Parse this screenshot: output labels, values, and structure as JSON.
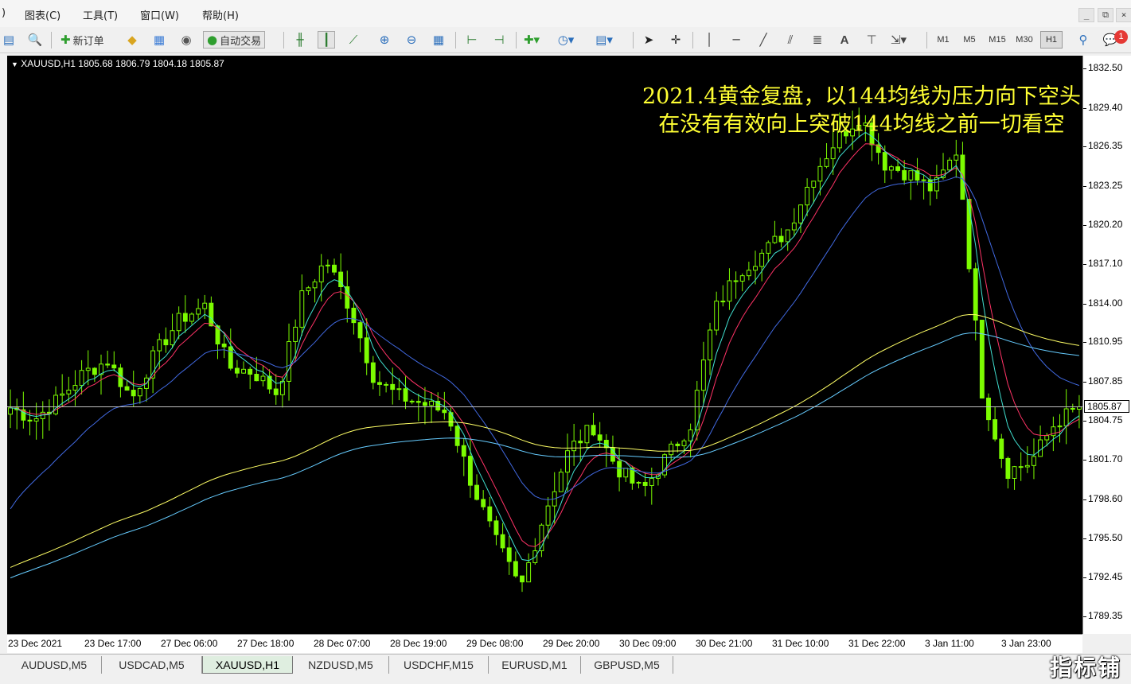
{
  "menu": {
    "items": [
      "图表(C)",
      "工具(T)",
      "窗口(W)",
      "帮助(H)"
    ],
    "first_fragment": ")"
  },
  "window_controls": {
    "minimize": "_",
    "restore": "⧉",
    "close": "×"
  },
  "toolbar": {
    "new_order_label": "新订单",
    "auto_trade_label": "自动交易",
    "timeframes": [
      "M1",
      "M5",
      "M15",
      "M30",
      "H1"
    ],
    "active_timeframe": "H1",
    "notification_count": "1",
    "icons": [
      "new-chart-icon",
      "profiles-icon",
      "new-order-icon",
      "metaeditor-icon",
      "market-watch-icon",
      "signals-icon",
      "auto-trading-icon",
      "bar-chart-icon",
      "candlestick-icon",
      "line-chart-icon",
      "zoom-in-icon",
      "zoom-out-icon",
      "tile-windows-icon",
      "autoscroll-icon",
      "chart-shift-icon",
      "indicators-icon",
      "periods-icon",
      "templates-icon",
      "cursor-icon",
      "crosshair-icon",
      "vertical-line-icon",
      "horizontal-line-icon",
      "trendline-icon",
      "equidistant-channel-icon",
      "fibonacci-icon",
      "text-icon",
      "text-label-icon",
      "arrows-icon",
      "search-icon",
      "chat-icon"
    ]
  },
  "chart": {
    "symbol_info": "XAUUSD,H1  1805.68 1806.79 1804.18 1805.87",
    "annotation_line1": "2021.4黄金复盘，以144均线为压力向下空头",
    "annotation_line2": "在没有有效向上突破144均线之前一切看空",
    "current_price": "1805.87",
    "background": "#000000",
    "candle_color": "#7cfc00",
    "ma_colors": {
      "fast": "#ff3366",
      "medium": "#40e0d0",
      "slow": "#4169e1",
      "ma144_yellow": "#ffff66",
      "ma169_cyan": "#66ccff"
    }
  },
  "chart_data": {
    "type": "candlestick",
    "symbol": "XAUUSD",
    "timeframe": "H1",
    "last_bar": {
      "open": 1805.68,
      "high": 1806.79,
      "low": 1804.18,
      "close": 1805.87
    },
    "price_ticks": [
      "1832.50",
      "1829.40",
      "1826.35",
      "1823.25",
      "1820.20",
      "1817.10",
      "1814.00",
      "1810.95",
      "1807.85",
      "1804.75",
      "1801.70",
      "1798.60",
      "1795.50",
      "1792.45",
      "1789.35"
    ],
    "time_ticks": [
      "23 Dec 2021",
      "23 Dec 17:00",
      "27 Dec 06:00",
      "27 Dec 18:00",
      "28 Dec 07:00",
      "28 Dec 19:00",
      "29 Dec 08:00",
      "29 Dec 20:00",
      "30 Dec 09:00",
      "30 Dec 21:00",
      "31 Dec 10:00",
      "31 Dec 22:00",
      "3 Jan 11:00",
      "3 Jan 23:00"
    ],
    "ylim": [
      1788.0,
      1833.5
    ],
    "approx_close_path": [
      1805.8,
      1804.9,
      1806.5,
      1808.5,
      1809.5,
      1806.5,
      1810.2,
      1812.8,
      1813.8,
      1809.0,
      1808.6,
      1806.9,
      1814.5,
      1817.4,
      1813.6,
      1808.0,
      1806.7,
      1806.1,
      1805.4,
      1799.8,
      1795.2,
      1791.5,
      1797.6,
      1802.5,
      1804.3,
      1801.0,
      1799.2,
      1801.9,
      1804.5,
      1813.5,
      1816.6,
      1818.0,
      1819.8,
      1824.0,
      1826.9,
      1828.8,
      1825.0,
      1824.2,
      1822.9,
      1826.2,
      1807.1,
      1800.8,
      1801.5,
      1804.6,
      1805.87
    ],
    "moving_averages": [
      {
        "name": "",
        "color": "#ff3366",
        "approx_end_value": 1804.8
      },
      {
        "name": "",
        "color": "#40e0d0",
        "approx_end_value": 1805.3
      },
      {
        "name": "",
        "color": "#4169e1",
        "approx_end_value": 1808.5
      },
      {
        "name": "",
        "color": "#ffff66",
        "approx_end_value": 1810.4
      },
      {
        "name": "",
        "color": "#66ccff",
        "approx_end_value": 1809.5
      }
    ]
  },
  "tabs": {
    "items": [
      "AUDUSD,M5",
      "USDCAD,M5",
      "XAUUSD,H1",
      "NZDUSD,M5",
      "USDCHF,M15",
      "EURUSD,M1",
      "GBPUSD,M5"
    ],
    "active": "XAUUSD,H1"
  },
  "watermark": "指标铺"
}
